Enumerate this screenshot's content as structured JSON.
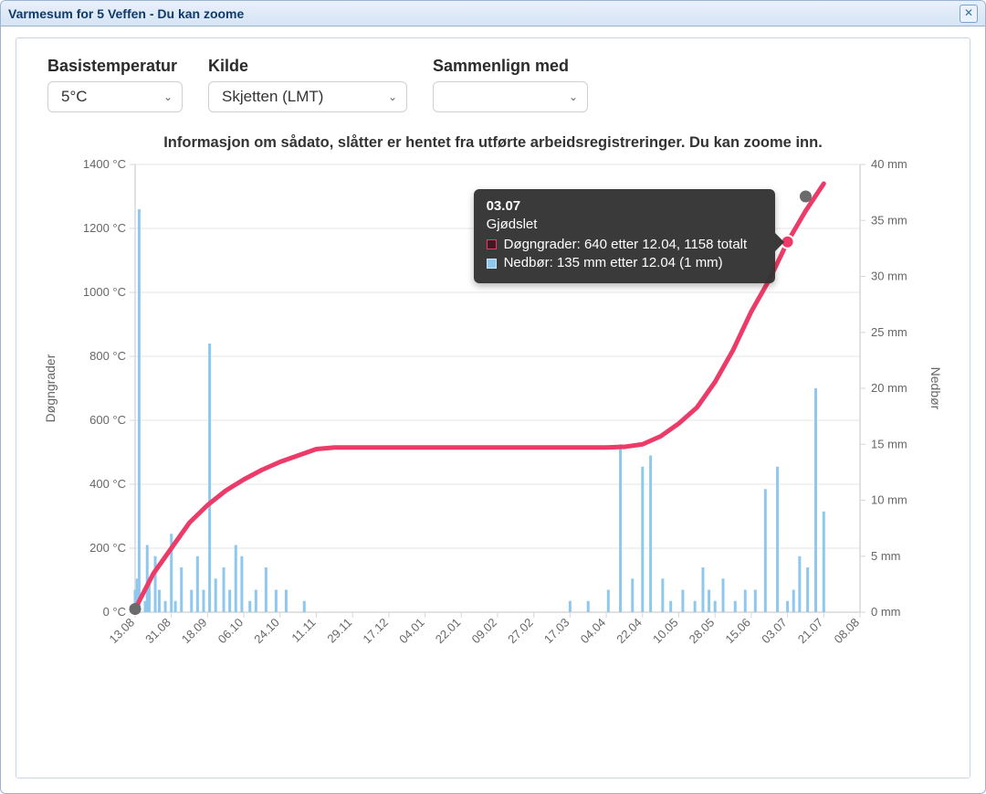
{
  "window": {
    "title": "Varmesum for 5 Veffen - Du kan zoome"
  },
  "controls": {
    "basis": {
      "label": "Basistemperatur",
      "value": "5°C"
    },
    "kilde": {
      "label": "Kilde",
      "value": "Skjetten (LMT)"
    },
    "compare": {
      "label": "Sammenlign med",
      "value": ""
    }
  },
  "chart_title": "Informasjon om sådato, slåtter er hentet fra utførte arbeidsregistreringer. Du kan zoome inn.",
  "axes": {
    "y_left_label": "Døgngrader",
    "y_right_label": "Nedbør",
    "y_left_unit": "°C",
    "y_right_unit": "mm"
  },
  "tooltip": {
    "date": "03.07",
    "subtitle": "Gjødslet",
    "row1": "Døgngrader: 640 etter 12.04, 1158 totalt",
    "row2": "Nedbør: 135 mm etter 12.04 (1 mm)"
  },
  "chart_data": {
    "type": "combo",
    "x_categories": [
      "13.08",
      "31.08",
      "18.09",
      "06.10",
      "24.10",
      "11.11",
      "29.11",
      "17.12",
      "04.01",
      "22.01",
      "09.02",
      "27.02",
      "17.03",
      "04.04",
      "22.04",
      "10.05",
      "28.05",
      "15.06",
      "03.07",
      "21.07",
      "08.08"
    ],
    "y_left": {
      "label": "Døgngrader",
      "unit": "°C",
      "range": [
        0,
        1400
      ],
      "ticks": [
        0,
        200,
        400,
        600,
        800,
        1000,
        1200,
        1400
      ]
    },
    "y_right": {
      "label": "Nedbør",
      "unit": "mm",
      "range": [
        0,
        40
      ],
      "ticks": [
        0,
        5,
        10,
        15,
        20,
        25,
        30,
        35,
        40
      ]
    },
    "series": [
      {
        "name": "Døgngrader",
        "type": "line",
        "color": "#ec3b68",
        "axis": "left",
        "x": [
          "13.08",
          "22.08",
          "31.08",
          "09.09",
          "18.09",
          "27.09",
          "06.10",
          "15.10",
          "24.10",
          "02.11",
          "11.11",
          "20.11",
          "04.01",
          "04.04",
          "13.04",
          "22.04",
          "01.05",
          "10.05",
          "19.05",
          "28.05",
          "06.06",
          "15.06",
          "24.06",
          "03.07",
          "12.07",
          "21.07"
        ],
        "values": [
          10,
          120,
          200,
          280,
          335,
          380,
          415,
          445,
          470,
          490,
          510,
          515,
          515,
          515,
          517,
          525,
          550,
          590,
          640,
          720,
          820,
          940,
          1040,
          1158,
          1255,
          1340
        ]
      },
      {
        "name": "Nedbør",
        "type": "bar",
        "color": "#8fc8ee",
        "axis": "right",
        "x": [
          "13.08",
          "14.08",
          "15.08",
          "18.08",
          "19.08",
          "20.08",
          "23.08",
          "25.08",
          "28.08",
          "31.08",
          "02.09",
          "05.09",
          "10.09",
          "13.09",
          "16.09",
          "19.09",
          "22.09",
          "26.09",
          "29.09",
          "02.10",
          "05.10",
          "09.10",
          "12.10",
          "17.10",
          "22.10",
          "27.10",
          "05.11",
          "17.03",
          "26.03",
          "05.04",
          "11.04",
          "17.04",
          "22.04",
          "26.04",
          "02.05",
          "06.05",
          "12.05",
          "18.05",
          "22.05",
          "25.05",
          "28.05",
          "01.06",
          "07.06",
          "12.06",
          "17.06",
          "22.06",
          "28.06",
          "03.07",
          "06.07",
          "09.07",
          "13.07",
          "17.07",
          "21.07"
        ],
        "values": [
          2,
          3,
          36,
          1,
          6,
          3,
          5,
          2,
          1,
          7,
          1,
          4,
          2,
          5,
          2,
          24,
          3,
          4,
          2,
          6,
          5,
          1,
          2,
          4,
          2,
          2,
          1,
          1,
          1,
          2,
          15,
          3,
          13,
          14,
          3,
          1,
          2,
          1,
          4,
          2,
          1,
          3,
          1,
          2,
          2,
          11,
          13,
          1,
          2,
          5,
          4,
          20,
          9
        ]
      }
    ],
    "events": [
      {
        "x": "13.08",
        "y_left": 10
      },
      {
        "x": "03.07",
        "y_left": 1158
      },
      {
        "x": "12.07",
        "y_left": 1300
      }
    ]
  }
}
